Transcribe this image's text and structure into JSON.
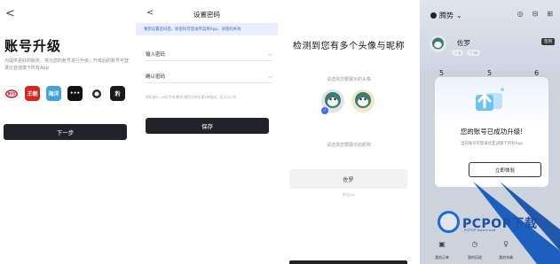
{
  "panel1": {
    "back_glyph": "<",
    "title": "账号升级",
    "description": "为提供更好的服务，将为您的账号进行升级，升级后的账号可登录比亚迪旗下所有App",
    "logos": [
      {
        "name": "dynasty",
        "text": "BYD",
        "color": "#c8102e"
      },
      {
        "name": "wangchao",
        "text": "王朝",
        "color": "#d6281e"
      },
      {
        "name": "haiyang",
        "text": "海洋",
        "color": "#3ea4dc"
      },
      {
        "name": "denza",
        "text": "•••",
        "color": "#111111"
      },
      {
        "name": "yangwang",
        "text": "◉",
        "color": "#ffffff"
      },
      {
        "name": "fangchengbao",
        "text": "豹",
        "color": "#1a1a1a"
      }
    ],
    "next_label": "下一步"
  },
  "panel2": {
    "back_glyph": "<",
    "title": "设置密码",
    "notice": "重新设置密码后，新密码可登录所选择App，旧密码失效",
    "password_label": "输入密码",
    "confirm_label": "确认密码",
    "eye_glyph": "◡",
    "rule": "密码由8~16位字母/数字/常用字符任意2种组成，区分大小写",
    "save_label": "保存"
  },
  "panel3": {
    "title": "检测到您有多个头像与昵称",
    "avatar_prompt": "请选择您要展示的头像",
    "nickname_prompt": "请选择您要展示的昵称",
    "nickname": "佐罗",
    "source": "来自app"
  },
  "panel4": {
    "tab_label": "腾势",
    "tab_chevron": "⌄",
    "icons": [
      "◎",
      "⊟",
      "⊞"
    ],
    "user_name": "佐罗",
    "badges": [
      "☆ 0",
      "♡ 10"
    ],
    "vip_label": "签到",
    "stats": [
      "5",
      "5",
      "6"
    ],
    "modal_title": "您的账号已成功升级!",
    "modal_desc": "当前账号可登录比亚迪旗下所有App",
    "modal_button": "立即体验",
    "watermark": "PCPOP下载",
    "watermark_sub": "PCPOP Download",
    "nav": [
      {
        "icon": "▣",
        "label": "我的订单"
      },
      {
        "icon": "◷",
        "label": "我的历程"
      },
      {
        "icon": "♀",
        "label": "我的车辆"
      }
    ],
    "accent_color": "#1d6bd6"
  }
}
